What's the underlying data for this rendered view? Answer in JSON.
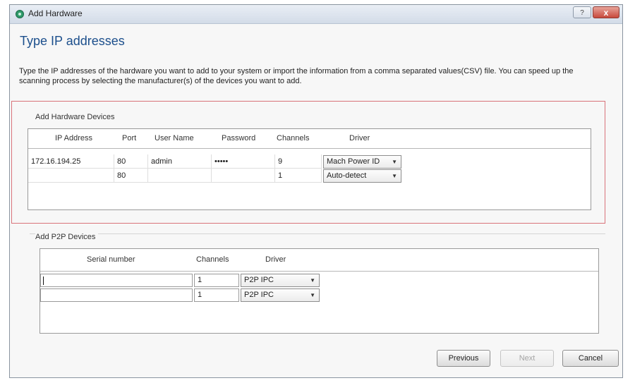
{
  "window": {
    "title": "Add Hardware",
    "help_label": "?",
    "close_label": "x"
  },
  "page": {
    "heading": "Type IP addresses",
    "description": "Type the IP addresses of the hardware you want to add to your system or import the information from a comma separated values(CSV) file. You can speed up the scanning process by selecting the manufacturer(s) of the devices you want to add."
  },
  "hardware": {
    "group_label": "Add Hardware Devices",
    "columns": [
      "IP Address",
      "Port",
      "User Name",
      "Password",
      "Channels",
      "Driver"
    ],
    "rows": [
      {
        "ip": "172.16.194.25",
        "port": "80",
        "user": "admin",
        "password": "•••••",
        "channels": "9",
        "driver": "Mach Power ID"
      },
      {
        "ip": "",
        "port": "80",
        "user": "",
        "password": "",
        "channels": "1",
        "driver": "Auto-detect"
      }
    ]
  },
  "p2p": {
    "group_label": "Add P2P Devices",
    "columns": [
      "Serial number",
      "Channels",
      "Driver"
    ],
    "rows": [
      {
        "serial": "",
        "channels": "1",
        "driver": "P2P IPC"
      },
      {
        "serial": "",
        "channels": "1",
        "driver": "P2P IPC"
      }
    ]
  },
  "buttons": {
    "previous": "Previous",
    "next": "Next",
    "cancel": "Cancel"
  },
  "icons": {
    "dropdown": "chevron-down-icon",
    "app": "app-icon"
  }
}
